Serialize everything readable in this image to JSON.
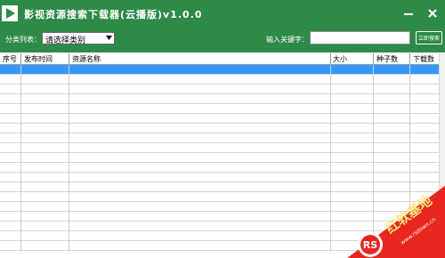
{
  "window": {
    "title": "影视资源搜索下载器(云播版)v1.0.0",
    "bg_color": "#2e8a48"
  },
  "toolbar": {
    "category_label": "分类列表：",
    "category_value": "请选择类别",
    "keyword_label": "输入关键字：",
    "keyword_value": "",
    "search_button": "立即搜索"
  },
  "table": {
    "columns": [
      "序号",
      "发布时间",
      "资源名称",
      "大小",
      "种子数",
      "下载数"
    ],
    "selected_color": "#3399ff",
    "rows": []
  },
  "watermark": {
    "badge": "RS",
    "text": "红软基地",
    "url": "www.rsdown.cn"
  }
}
